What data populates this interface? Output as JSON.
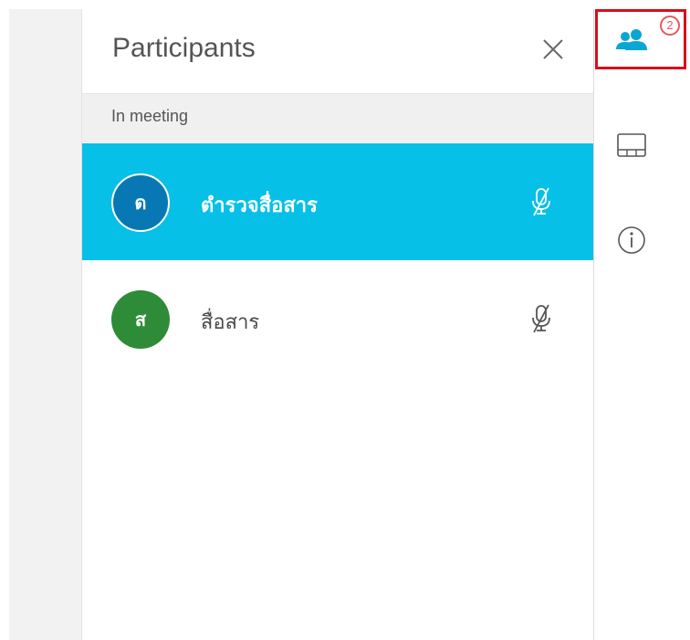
{
  "panel": {
    "title": "Participants",
    "section_label": "In meeting"
  },
  "participants": [
    {
      "initial": "ด",
      "name": "ตำรวจสื่อสาร",
      "avatar_color": "#0778b3",
      "selected": true,
      "mic": "muted-mic-icon"
    },
    {
      "initial": "ส",
      "name": "สื่อสาร",
      "avatar_color": "#2e8b37",
      "selected": false,
      "mic": "muted-mic-icon"
    }
  ],
  "rail": {
    "participants_count": "2"
  },
  "colors": {
    "selected_row": "#06c0e7",
    "active_outline": "#d90f1c",
    "badge": "#e45b5b",
    "people_icon": "#0aa6d6"
  }
}
